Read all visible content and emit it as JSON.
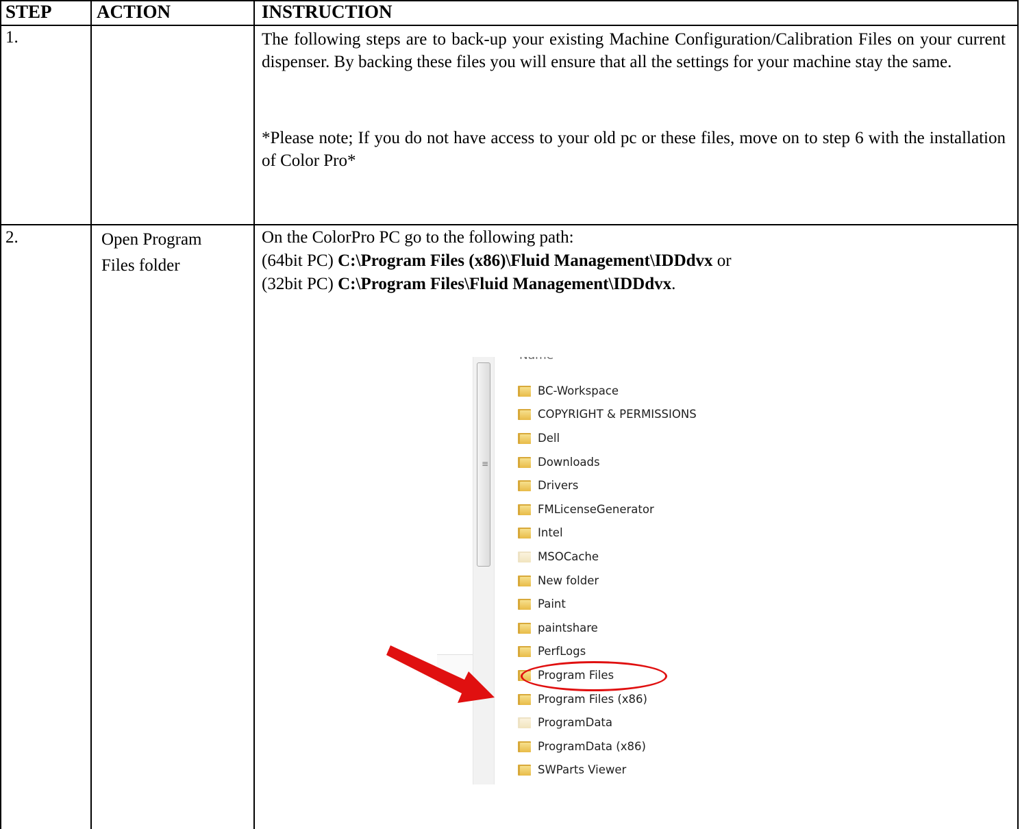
{
  "header": {
    "step": "STEP",
    "action": "ACTION",
    "instruction": "INSTRUCTION"
  },
  "rows": [
    {
      "step": "1.",
      "action": "",
      "paragraphs": [
        "The following steps are to back-up your existing Machine Configuration/Calibration Files on your current dispenser. By backing these files you will ensure that all the settings for your machine stay the same.",
        "*Please note; If you do not have access to your old pc or these files, move on to step 6 with the installation of Color Pro*"
      ]
    },
    {
      "step": "2.",
      "action_line1": "Open Program",
      "action_line2": "Files folder",
      "line1": "On the ColorPro PC go to the following path:",
      "line2_prefix": "(64bit PC) ",
      "line2_path": "C:\\Program Files (x86)\\Fluid Management\\IDDdvx",
      "line2_suffix": " or",
      "line3_prefix": "(32bit PC) ",
      "line3_path": "C:\\Program Files\\Fluid Management\\IDDdvx",
      "line3_suffix": "."
    }
  ],
  "screenshot": {
    "column_header": "Name",
    "highlight_color": "#e01010",
    "folder_icon": "folder-icon",
    "folders": [
      "BC-Workspace",
      "COPYRIGHT & PERMISSIONS",
      "Dell",
      "Downloads",
      "Drivers",
      "FMLicenseGenerator",
      "Intel",
      "MSOCache",
      "New folder",
      "Paint",
      "paintshare",
      "PerfLogs",
      "Program Files",
      "Program Files (x86)",
      "ProgramData",
      "ProgramData (x86)",
      "SWParts Viewer"
    ],
    "highlighted": "Program Files (x86)"
  }
}
